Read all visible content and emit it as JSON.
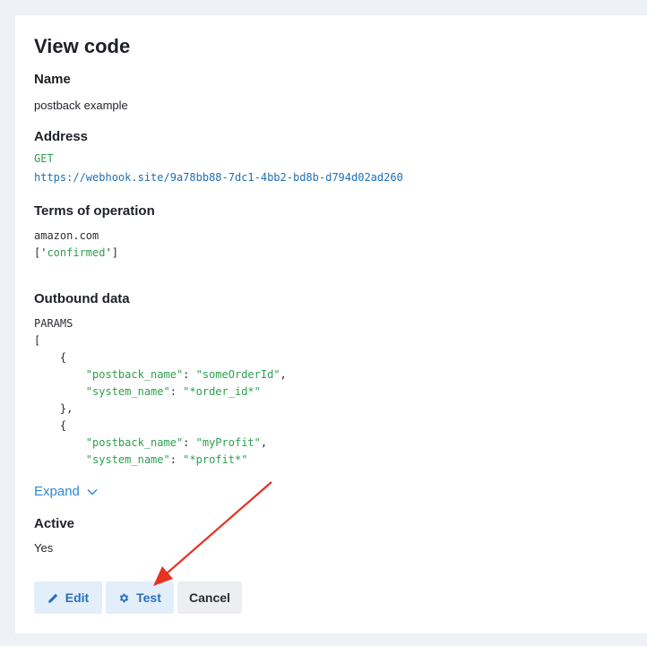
{
  "page": {
    "title": "View code"
  },
  "name_section": {
    "label": "Name",
    "value": "postback example"
  },
  "address_section": {
    "label": "Address",
    "method": "GET",
    "url": "https://webhook.site/9a78bb88-7dc1-4bb2-bd8b-d794d02ad260"
  },
  "terms_section": {
    "label": "Terms of operation",
    "domain": "amazon.com",
    "status_open": "['",
    "status_value": "confirmed",
    "status_close": "']"
  },
  "outbound_section": {
    "label": "Outbound data",
    "params_heading": "PARAMS",
    "lines": [
      {
        "indent": "",
        "parts": [
          {
            "t": "[",
            "c": "dark"
          }
        ]
      },
      {
        "indent": "    ",
        "parts": [
          {
            "t": "{",
            "c": "dark"
          }
        ]
      },
      {
        "indent": "        ",
        "parts": [
          {
            "t": "\"postback_name\"",
            "c": "green"
          },
          {
            "t": ": ",
            "c": "dark"
          },
          {
            "t": "\"someOrderId\"",
            "c": "green"
          },
          {
            "t": ",",
            "c": "dark"
          }
        ]
      },
      {
        "indent": "        ",
        "parts": [
          {
            "t": "\"system_name\"",
            "c": "green"
          },
          {
            "t": ": ",
            "c": "dark"
          },
          {
            "t": "\"*order_id*\"",
            "c": "green"
          }
        ]
      },
      {
        "indent": "    ",
        "parts": [
          {
            "t": "},",
            "c": "dark"
          }
        ]
      },
      {
        "indent": "    ",
        "parts": [
          {
            "t": "{",
            "c": "dark"
          }
        ]
      },
      {
        "indent": "        ",
        "parts": [
          {
            "t": "\"postback_name\"",
            "c": "green"
          },
          {
            "t": ": ",
            "c": "dark"
          },
          {
            "t": "\"myProfit\"",
            "c": "green"
          },
          {
            "t": ",",
            "c": "dark"
          }
        ]
      },
      {
        "indent": "        ",
        "parts": [
          {
            "t": "\"system_name\"",
            "c": "green"
          },
          {
            "t": ": ",
            "c": "dark"
          },
          {
            "t": "\"*profit*\"",
            "c": "green"
          }
        ]
      }
    ],
    "expand_label": "Expand"
  },
  "active_section": {
    "label": "Active",
    "value": "Yes"
  },
  "actions": {
    "edit_label": "Edit",
    "test_label": "Test",
    "cancel_label": "Cancel"
  },
  "colors": {
    "accent": "#2f86d6",
    "code_green": "#2e9e4f",
    "url_blue": "#1f6fb5",
    "button_bg": "#e3eefb",
    "annotation_arrow": "#e53222"
  },
  "icons": {
    "edit": "pencil-icon",
    "test": "gear-icon",
    "expand": "chevron-down-icon"
  }
}
